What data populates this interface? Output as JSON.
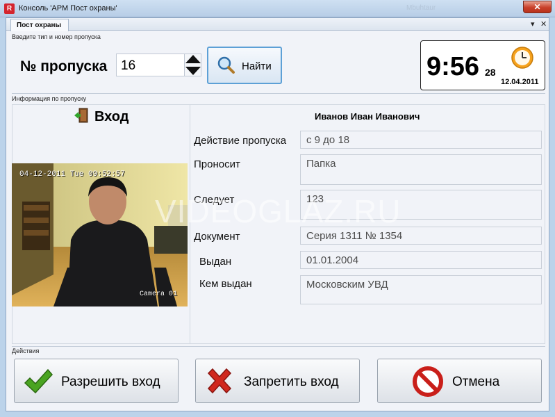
{
  "window": {
    "title": "Консоль 'АРМ Пост охраны'",
    "faint_title": "Mbuhtaur",
    "close_glyph": "✕"
  },
  "tab": {
    "label": "Пост охраны",
    "pin_glyph": "▾",
    "close_glyph": "✕"
  },
  "search_section": {
    "caption": "Введите тип и номер пропуска",
    "pass_label": "№ пропуска",
    "pass_value": "16",
    "find_label": "Найти"
  },
  "clock": {
    "time": "9:56",
    "seconds": "28",
    "date": "12.04.2011"
  },
  "info_section": {
    "caption": "Информация по пропуску",
    "direction": "Вход",
    "camera_timestamp": "04-12-2011 Tue 09:52:57",
    "camera_name": "Camera 01",
    "person_name": "Иванов Иван Иванович",
    "fields": [
      {
        "label": "Действие пропуска",
        "value": "с 9 до 18"
      },
      {
        "label": "Проносит",
        "value": "Папка"
      },
      {
        "label": "Следует",
        "value": "123"
      },
      {
        "label": "Документ",
        "value": "Серия 1311 № 1354"
      },
      {
        "label": "Выдан",
        "value": "01.01.2004"
      },
      {
        "label": "Кем выдан",
        "value": "Московским УВД"
      }
    ]
  },
  "watermark": "VIDEOGLAZ.RU",
  "actions_section": {
    "caption": "Действия",
    "allow_label": "Разрешить вход",
    "deny_label": "Запретить вход",
    "cancel_label": "Отмена"
  },
  "colors": {
    "accent": "#5da0d6",
    "allow": "#4aa421",
    "deny": "#d0281e"
  }
}
